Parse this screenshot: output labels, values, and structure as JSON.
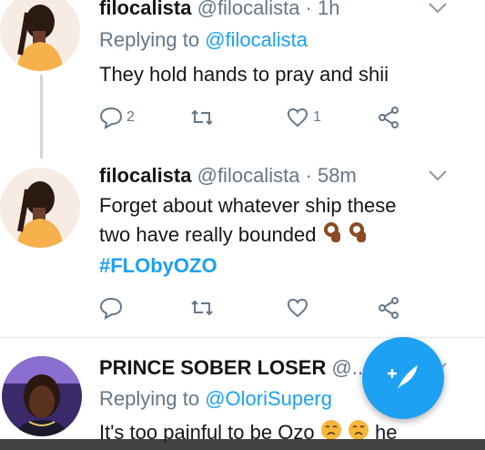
{
  "tweets": [
    {
      "name": "filocalista",
      "handle": "@filocalista",
      "dot": "·",
      "time": "1h",
      "replying_prefix": "Replying to",
      "replying_to": "@filocalista",
      "text": "They hold hands to pray and shii",
      "replies": "2",
      "retweets": "",
      "likes": "1"
    },
    {
      "name": "filocalista",
      "handle": "@filocalista",
      "dot": "·",
      "time": "58m",
      "text_line1": "Forget about whatever ship these",
      "text_line2": "two have really bounded",
      "hashtag": "#FLObyOZO",
      "replies": "",
      "retweets": "",
      "likes": ""
    },
    {
      "name": "PRINCE SOBER LOSER",
      "handle": "@...",
      "replying_prefix": "Replying to",
      "replying_to": "@OloriSuperg",
      "text_start": "It's too painful to be Ozo",
      "text_end": "he"
    }
  ],
  "colors": {
    "accent": "#1da1f2",
    "muted": "#657786",
    "text": "#14171a"
  },
  "icons": [
    "reply-icon",
    "retweet-icon",
    "like-icon",
    "share-icon",
    "chevron-down-icon",
    "compose-tweet-icon"
  ]
}
